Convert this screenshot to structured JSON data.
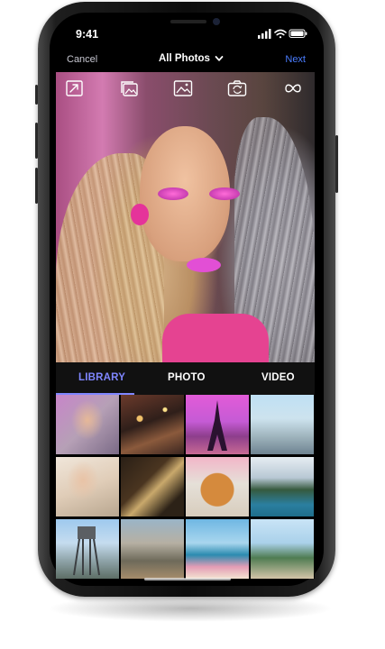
{
  "status_bar": {
    "time": "9:41"
  },
  "nav": {
    "cancel_label": "Cancel",
    "title": "All Photos",
    "next_label": "Next"
  },
  "toolbar": {
    "icons": [
      "expand-icon",
      "image-stack-icon",
      "image-icon",
      "camera-rotate-icon",
      "infinity-icon"
    ]
  },
  "tabs": [
    {
      "label": "LIBRARY",
      "selected": true
    },
    {
      "label": "PHOTO",
      "selected": false
    },
    {
      "label": "VIDEO",
      "selected": false
    }
  ],
  "colors": {
    "accent": "#7f86ff",
    "next": "#4a7dff",
    "background": "#000000"
  },
  "grid": {
    "columns": 4,
    "rows_visible": 3
  }
}
